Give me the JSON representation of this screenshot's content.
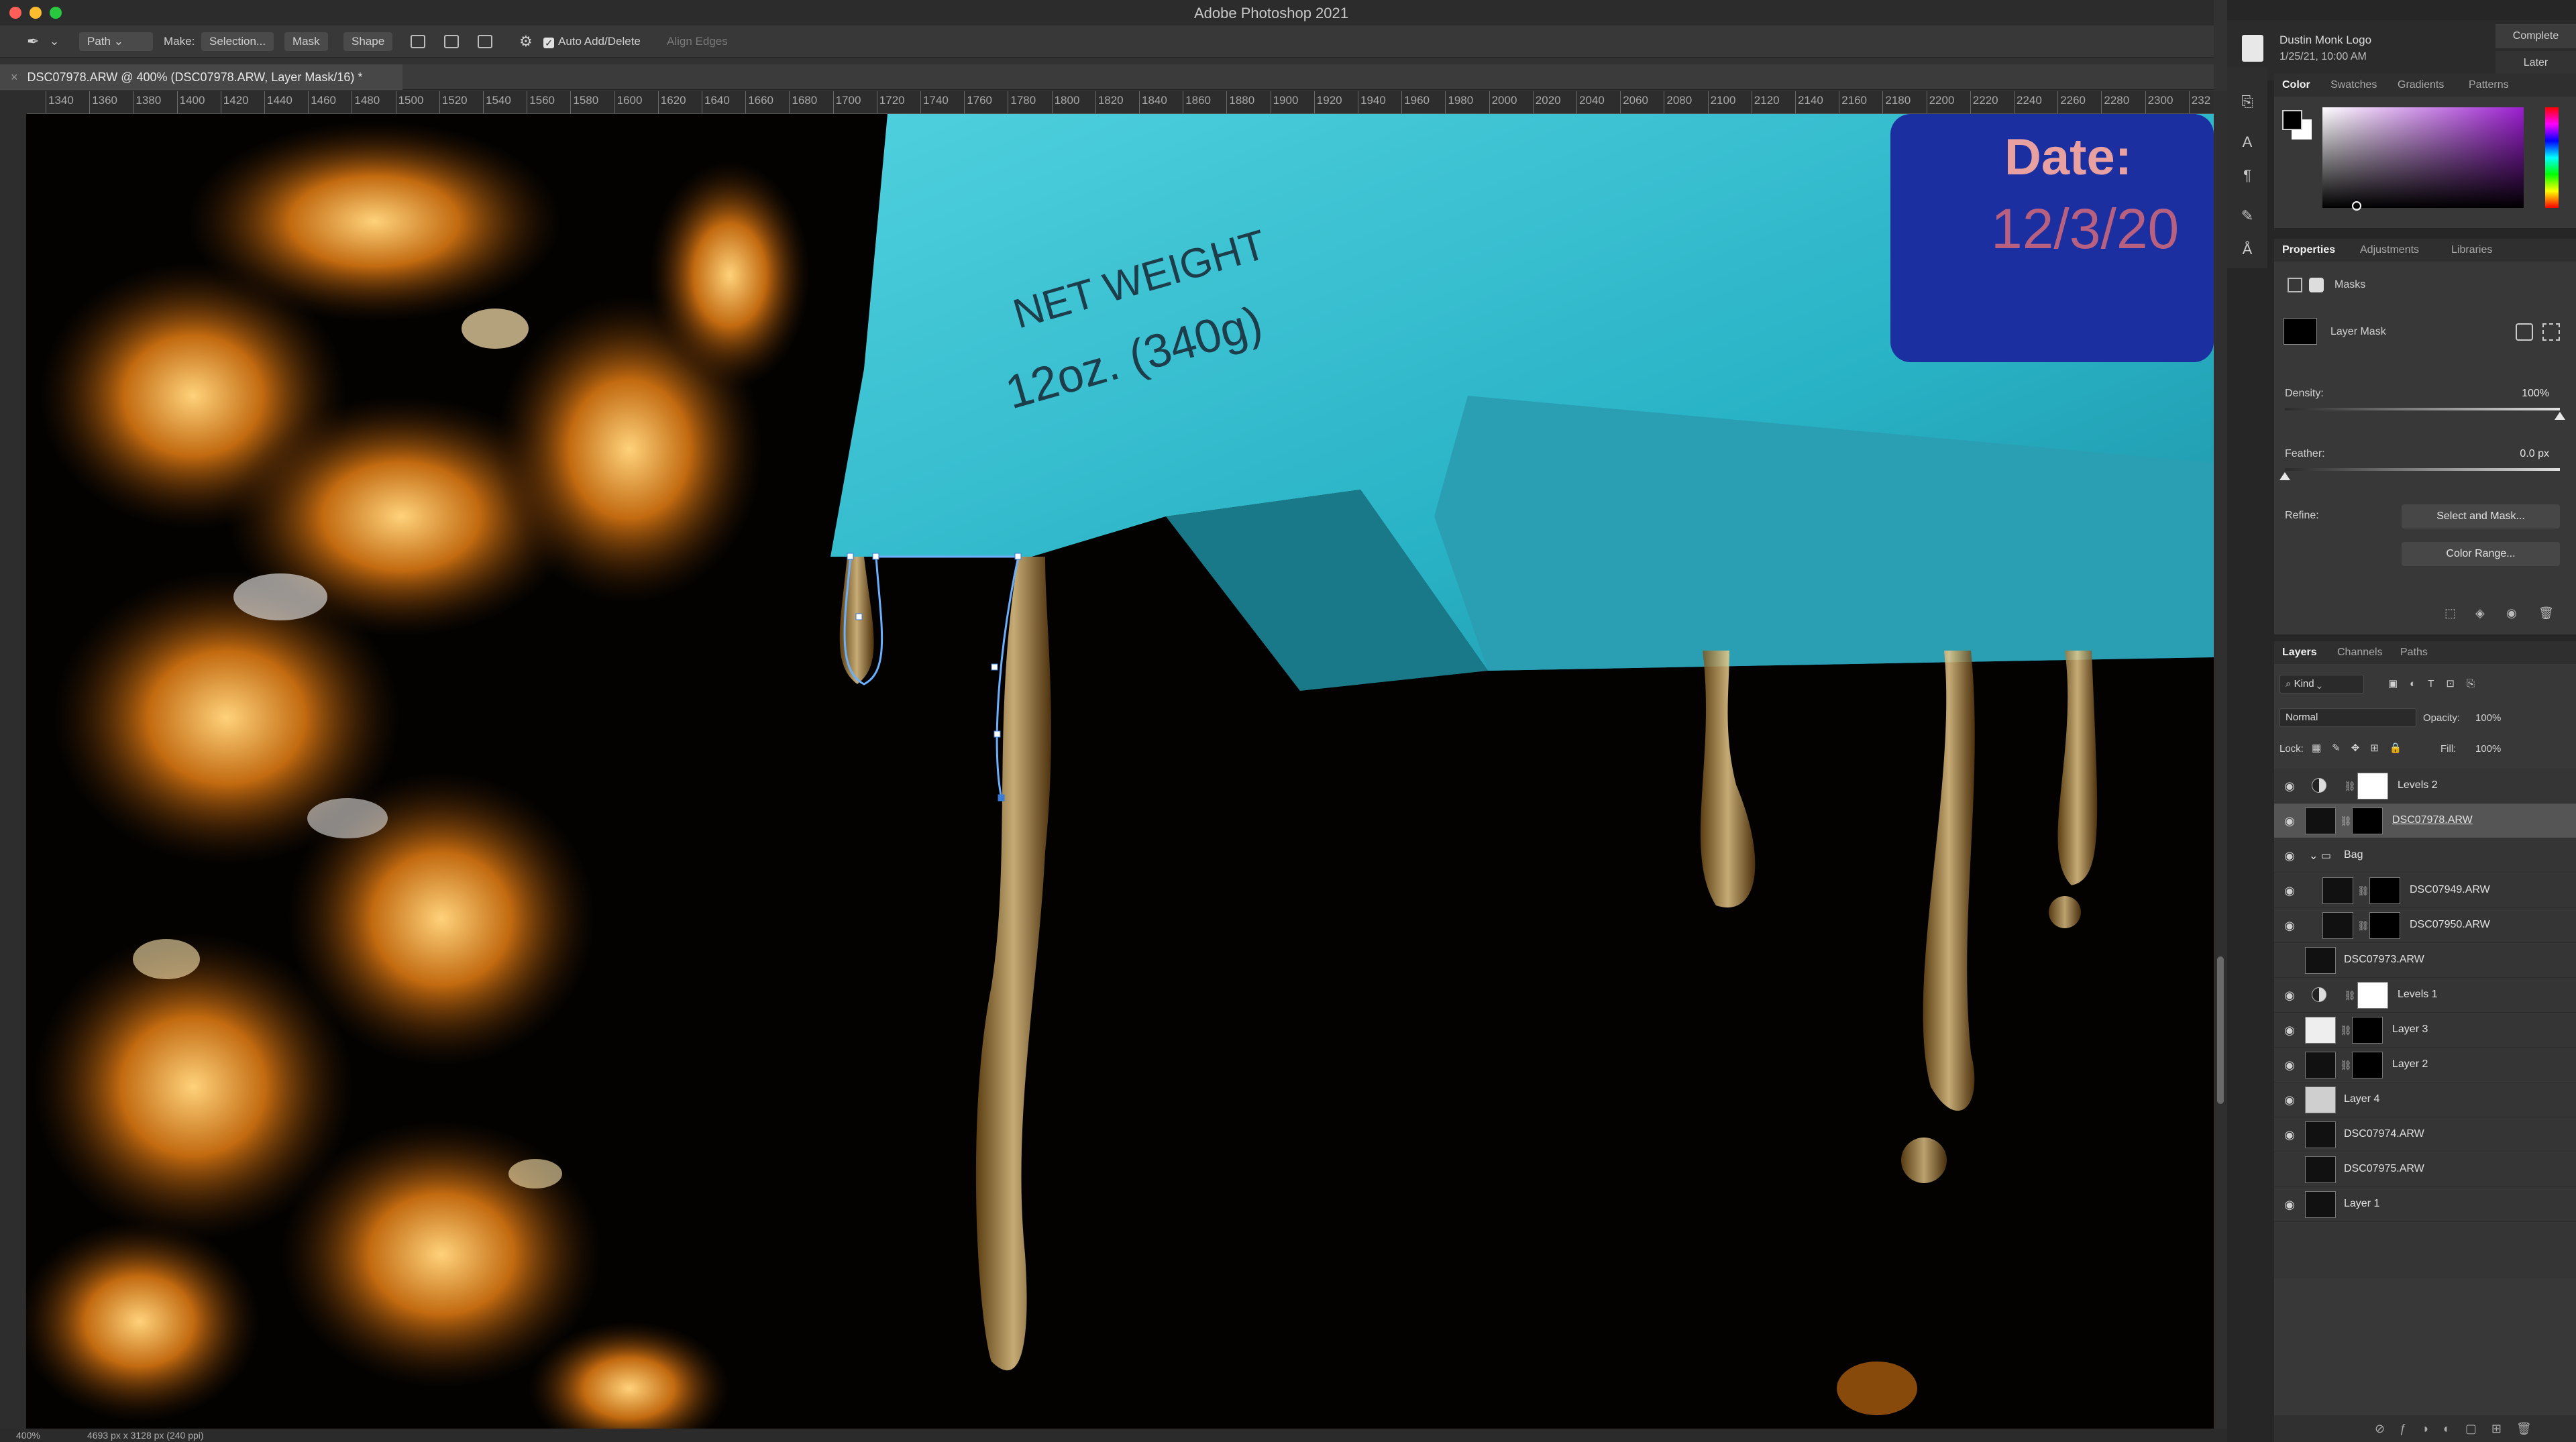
{
  "app": {
    "title": "Adobe Photoshop 2021"
  },
  "options": {
    "tool_mode": "Path",
    "make_label": "Make:",
    "selection_btn": "Selection...",
    "mask_btn": "Mask",
    "shape_btn": "Shape",
    "auto_add_delete": "Auto Add/Delete",
    "align_edges": "Align Edges"
  },
  "document": {
    "tab_title": "DSC07978.ARW @ 400% (DSC07978.ARW, Layer Mask/16) *",
    "close": "×"
  },
  "ruler": {
    "ticks": [
      "1340",
      "1360",
      "1380",
      "1400",
      "1420",
      "1440",
      "1460",
      "1480",
      "1500",
      "1520",
      "1540",
      "1560",
      "1580",
      "1600",
      "1620",
      "1640",
      "1660",
      "1680",
      "1700",
      "1720",
      "1740",
      "1760",
      "1780",
      "1800",
      "1820",
      "1840",
      "1860",
      "1880",
      "1900",
      "1920",
      "1940",
      "1960",
      "1980",
      "2000",
      "2020",
      "2040",
      "2060",
      "2080",
      "2100",
      "2120",
      "2140",
      "2160",
      "2180",
      "2200",
      "2220",
      "2240",
      "2260",
      "2280",
      "2300",
      "232"
    ]
  },
  "status": {
    "zoom": "400%",
    "doc_size": "4693 px x 3128 px (240 ppi)"
  },
  "canvas": {
    "bag_text_weight_1": "NET WEIGHT",
    "bag_text_weight_2": "12oz. (340g)",
    "bag_date_label": "Date:",
    "bag_date_value": "12/3/20"
  },
  "notification": {
    "title": "Dustin Monk Logo",
    "date": "1/25/21, 10:00 AM",
    "complete_btn": "Complete",
    "later_btn": "Later"
  },
  "color_panel": {
    "tabs": [
      "Color",
      "Swatches",
      "Gradients",
      "Patterns"
    ],
    "fg_color": "#000000",
    "bg_color": "#ffffff"
  },
  "properties_panel": {
    "tabs": [
      "Properties",
      "Adjustments",
      "Libraries"
    ],
    "masks_label": "Masks",
    "layer_mask_label": "Layer Mask",
    "density_label": "Density:",
    "density_value": "100%",
    "density_fraction": 1.0,
    "feather_label": "Feather:",
    "feather_value": "0.0 px",
    "feather_fraction": 0.0,
    "refine_label": "Refine:",
    "select_and_mask_btn": "Select and Mask...",
    "color_range_btn": "Color Range..."
  },
  "layers_panel": {
    "tabs": [
      "Layers",
      "Channels",
      "Paths"
    ],
    "kind_label": "Kind",
    "blend_mode": "Normal",
    "opacity_label": "Opacity:",
    "opacity_value": "100%",
    "lock_label": "Lock:",
    "fill_label": "Fill:",
    "fill_value": "100%",
    "layers": [
      {
        "name": "Levels 2",
        "visible": true,
        "type": "adjustment"
      },
      {
        "name": "DSC07978.ARW",
        "visible": true,
        "type": "image-mask",
        "selected": true
      },
      {
        "name": "Bag",
        "visible": true,
        "type": "group"
      },
      {
        "name": "DSC07949.ARW",
        "visible": true,
        "type": "image-mask"
      },
      {
        "name": "DSC07950.ARW",
        "visible": true,
        "type": "image-mask"
      },
      {
        "name": "DSC07973.ARW",
        "visible": false,
        "type": "image"
      },
      {
        "name": "Levels 1",
        "visible": true,
        "type": "adjustment"
      },
      {
        "name": "Layer 3",
        "visible": true,
        "type": "image-mask"
      },
      {
        "name": "Layer 2",
        "visible": true,
        "type": "image-mask"
      },
      {
        "name": "Layer 4",
        "visible": true,
        "type": "image"
      },
      {
        "name": "DSC07974.ARW",
        "visible": true,
        "type": "image"
      },
      {
        "name": "DSC07975.ARW",
        "visible": false,
        "type": "image"
      },
      {
        "name": "Layer 1",
        "visible": true,
        "type": "image"
      }
    ]
  }
}
